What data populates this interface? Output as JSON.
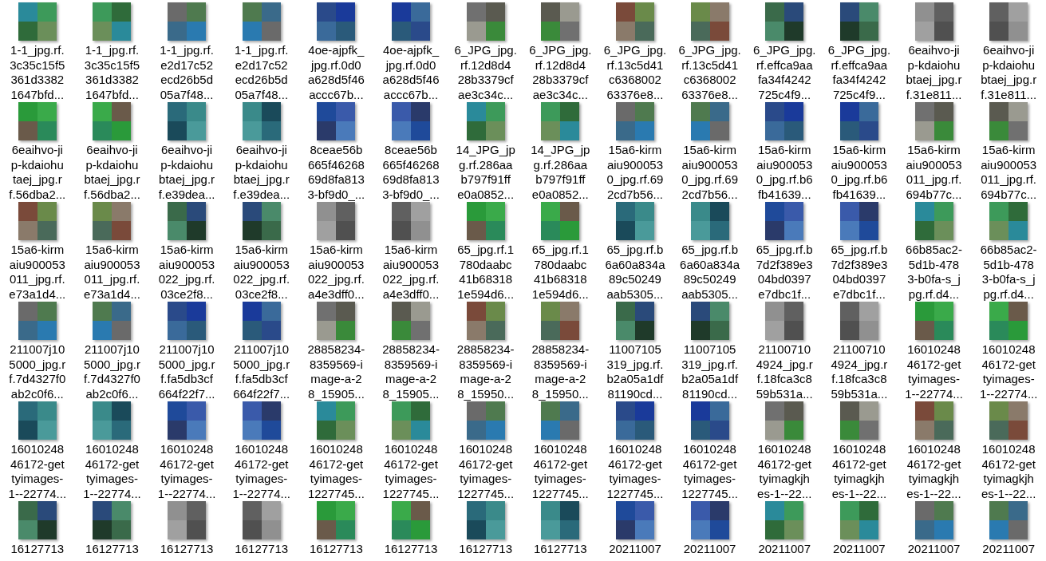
{
  "files": [
    {
      "label": [
        "1-1_jpg.rf.",
        "3c35c15f5",
        "361d3382",
        "1647bfd..."
      ]
    },
    {
      "label": [
        "1-1_jpg.rf.",
        "3c35c15f5",
        "361d3382",
        "1647bfd..."
      ]
    },
    {
      "label": [
        "1-1_jpg.rf.",
        "e2d17c52",
        "ecd26b5d",
        "05a7f48..."
      ]
    },
    {
      "label": [
        "1-1_jpg.rf.",
        "e2d17c52",
        "ecd26b5d",
        "05a7f48..."
      ]
    },
    {
      "label": [
        "4oe-ajpfk_",
        "jpg.rf.0d0",
        "a628d5f46",
        "accc67b..."
      ]
    },
    {
      "label": [
        "4oe-ajpfk_",
        "jpg.rf.0d0",
        "a628d5f46",
        "accc67b..."
      ]
    },
    {
      "label": [
        "6_JPG_jpg.",
        "rf.12d8d4",
        "28b3379cf",
        "ae3c34c..."
      ]
    },
    {
      "label": [
        "6_JPG_jpg.",
        "rf.12d8d4",
        "28b3379cf",
        "ae3c34c..."
      ]
    },
    {
      "label": [
        "6_JPG_jpg.",
        "rf.13c5d41",
        "c6368002",
        "63376e8..."
      ]
    },
    {
      "label": [
        "6_JPG_jpg.",
        "rf.13c5d41",
        "c6368002",
        "63376e8..."
      ]
    },
    {
      "label": [
        "6_JPG_jpg.",
        "rf.effca9aa",
        "fa34f4242",
        "725c4f9..."
      ]
    },
    {
      "label": [
        "6_JPG_jpg.",
        "rf.effca9aa",
        "fa34f4242",
        "725c4f9..."
      ]
    },
    {
      "label": [
        "6eaihvo-ji",
        "p-kdaiohu",
        "btaej_jpg.r",
        "f.31e811..."
      ]
    },
    {
      "label": [
        "6eaihvo-ji",
        "p-kdaiohu",
        "btaej_jpg.r",
        "f.31e811..."
      ]
    },
    {
      "label": [
        "6eaihvo-ji",
        "p-kdaiohu",
        "taej_jpg.r",
        "f.56dba2..."
      ]
    },
    {
      "label": [
        "6eaihvo-ji",
        "p-kdaiohu",
        "btaej_jpg.r",
        "f.56dba2..."
      ]
    },
    {
      "label": [
        "6eaihvo-ji",
        "p-kdaiohu",
        "btaej_jpg.r",
        "f.e39dea..."
      ]
    },
    {
      "label": [
        "6eaihvo-ji",
        "p-kdaiohu",
        "btaej_jpg.r",
        "f.e39dea..."
      ]
    },
    {
      "label": [
        "8ceae56b",
        "665f46268",
        "69d8fa813",
        "3-bf9d0_..."
      ]
    },
    {
      "label": [
        "8ceae56b",
        "665f46268",
        "69d8fa813",
        "3-bf9d0_..."
      ]
    },
    {
      "label": [
        "14_JPG_jp",
        "g.rf.286aa",
        "b797f91ff",
        "e0a0852..."
      ]
    },
    {
      "label": [
        "14_JPG_jp",
        "g.rf.286aa",
        "b797f91ff",
        "e0a0852..."
      ]
    },
    {
      "label": [
        "15a6-kirm",
        "aiu900053",
        "0_jpg.rf.69",
        "2cd7b56..."
      ]
    },
    {
      "label": [
        "15a6-kirm",
        "aiu900053",
        "0_jpg.rf.69",
        "2cd7b56..."
      ]
    },
    {
      "label": [
        "15a6-kirm",
        "aiu900053",
        "0_jpg.rf.b6",
        "fb41639..."
      ]
    },
    {
      "label": [
        "15a6-kirm",
        "aiu900053",
        "0_jpg.rf.b6",
        "fb41639..."
      ]
    },
    {
      "label": [
        "15a6-kirm",
        "aiu900053",
        "011_jpg.rf.",
        "694b77c..."
      ]
    },
    {
      "label": [
        "15a6-kirm",
        "aiu900053",
        "011_jpg.rf.",
        "694b77c..."
      ]
    },
    {
      "label": [
        "15a6-kirm",
        "aiu900053",
        "011_jpg.rf.",
        "e73a1d4..."
      ]
    },
    {
      "label": [
        "15a6-kirm",
        "aiu900053",
        "011_jpg.rf.",
        "e73a1d4..."
      ]
    },
    {
      "label": [
        "15a6-kirm",
        "aiu900053",
        "022_jpg.rf.",
        "03ce2f8..."
      ]
    },
    {
      "label": [
        "15a6-kirm",
        "aiu900053",
        "022_jpg.rf.",
        "03ce2f8..."
      ]
    },
    {
      "label": [
        "15a6-kirm",
        "aiu900053",
        "022_jpg.rf.",
        "a4e3dff0..."
      ]
    },
    {
      "label": [
        "15a6-kirm",
        "aiu900053",
        "022_jpg.rf.",
        "a4e3dff0..."
      ]
    },
    {
      "label": [
        "65_jpg.rf.1",
        "780daabc",
        "41b68318",
        "1e594d6..."
      ]
    },
    {
      "label": [
        "65_jpg.rf.1",
        "780daabc",
        "41b68318",
        "1e594d6..."
      ]
    },
    {
      "label": [
        "65_jpg.rf.b",
        "6a60a834a",
        "89c50249",
        "aab5305..."
      ]
    },
    {
      "label": [
        "65_jpg.rf.b",
        "6a60a834a",
        "89c50249",
        "aab5305..."
      ]
    },
    {
      "label": [
        "65_jpg.rf.b",
        "7d2f389e3",
        "04bd0397",
        "e7dbc1f..."
      ]
    },
    {
      "label": [
        "65_jpg.rf.b",
        "7d2f389e3",
        "04bd0397",
        "e7dbc1f..."
      ]
    },
    {
      "label": [
        "66b85ac2-",
        "5d1b-478",
        "3-b0fa-s_j",
        "pg.rf.d4..."
      ]
    },
    {
      "label": [
        "66b85ac2-",
        "5d1b-478",
        "3-b0fa-s_j",
        "pg.rf.d4..."
      ]
    },
    {
      "label": [
        "211007j10",
        "5000_jpg.r",
        "f.7d4327f0",
        "ab2c0f6..."
      ]
    },
    {
      "label": [
        "211007j10",
        "5000_jpg.r",
        "f.7d4327f0",
        "ab2c0f6..."
      ]
    },
    {
      "label": [
        "211007j10",
        "5000_jpg.r",
        "f.fa5db3cf",
        "664f22f7..."
      ]
    },
    {
      "label": [
        "211007j10",
        "5000_jpg.r",
        "f.fa5db3cf",
        "664f22f7..."
      ]
    },
    {
      "label": [
        "28858234-",
        "8359569-i",
        "mage-a-2",
        "8_15905..."
      ]
    },
    {
      "label": [
        "28858234-",
        "8359569-i",
        "mage-a-2",
        "8_15905..."
      ]
    },
    {
      "label": [
        "28858234-",
        "8359569-i",
        "mage-a-2",
        "8_15950..."
      ]
    },
    {
      "label": [
        "28858234-",
        "8359569-i",
        "mage-a-2",
        "8_15950..."
      ]
    },
    {
      "label": [
        "11007105",
        "319_jpg.rf.",
        "b2a05a1df",
        "81190cd..."
      ]
    },
    {
      "label": [
        "11007105",
        "319_jpg.rf.",
        "b2a05a1df",
        "81190cd..."
      ]
    },
    {
      "label": [
        "21100710",
        "4924_jpg.r",
        "f.18fca3c8",
        "59b531a..."
      ]
    },
    {
      "label": [
        "21100710",
        "4924_jpg.r",
        "f.18fca3c8",
        "59b531a..."
      ]
    },
    {
      "label": [
        "16010248",
        "46172-get",
        "tyimages-",
        "1--22774..."
      ]
    },
    {
      "label": [
        "16010248",
        "46172-get",
        "tyimages-",
        "1--22774..."
      ]
    },
    {
      "label": [
        "16010248",
        "46172-get",
        "tyimages-",
        "1--22774..."
      ]
    },
    {
      "label": [
        "16010248",
        "46172-get",
        "tyimages-",
        "1--22774..."
      ]
    },
    {
      "label": [
        "16010248",
        "46172-get",
        "tyimages-",
        "1--22774..."
      ]
    },
    {
      "label": [
        "16010248",
        "46172-get",
        "tyimages-",
        "1--22774..."
      ]
    },
    {
      "label": [
        "16010248",
        "46172-get",
        "tyimages-",
        "1227745..."
      ]
    },
    {
      "label": [
        "16010248",
        "46172-get",
        "tyimages-",
        "1227745..."
      ]
    },
    {
      "label": [
        "16010248",
        "46172-get",
        "tyimages-",
        "1227745..."
      ]
    },
    {
      "label": [
        "16010248",
        "46172-get",
        "tyimages-",
        "1227745..."
      ]
    },
    {
      "label": [
        "16010248",
        "46172-get",
        "tyimages-",
        "1227745..."
      ]
    },
    {
      "label": [
        "16010248",
        "46172-get",
        "tyimages-",
        "1227745..."
      ]
    },
    {
      "label": [
        "16010248",
        "46172-get",
        "tyimagkjh",
        "es-1--22..."
      ]
    },
    {
      "label": [
        "16010248",
        "46172-get",
        "tyimagkjh",
        "es-1--22..."
      ]
    },
    {
      "label": [
        "16010248",
        "46172-get",
        "tyimagkjh",
        "es-1--22..."
      ]
    },
    {
      "label": [
        "16010248",
        "46172-get",
        "tyimagkjh",
        "es-1--22..."
      ]
    },
    {
      "label": [
        "16127713"
      ]
    },
    {
      "label": [
        "16127713"
      ]
    },
    {
      "label": [
        "16127713"
      ]
    },
    {
      "label": [
        "16127713"
      ]
    },
    {
      "label": [
        "16127713"
      ]
    },
    {
      "label": [
        "16127713"
      ]
    },
    {
      "label": [
        "16127713"
      ]
    },
    {
      "label": [
        "16127713"
      ]
    },
    {
      "label": [
        "20211007"
      ]
    },
    {
      "label": [
        "20211007"
      ]
    },
    {
      "label": [
        "20211007"
      ]
    },
    {
      "label": [
        "20211007"
      ]
    },
    {
      "label": [
        "20211007"
      ]
    },
    {
      "label": [
        "20211007"
      ]
    }
  ]
}
